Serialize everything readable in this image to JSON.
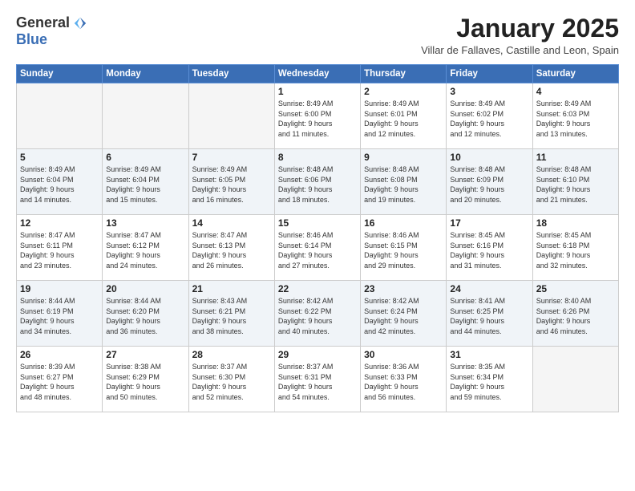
{
  "logo": {
    "general": "General",
    "blue": "Blue"
  },
  "header": {
    "month": "January 2025",
    "location": "Villar de Fallaves, Castille and Leon, Spain"
  },
  "weekdays": [
    "Sunday",
    "Monday",
    "Tuesday",
    "Wednesday",
    "Thursday",
    "Friday",
    "Saturday"
  ],
  "weeks": [
    [
      {
        "day": "",
        "info": ""
      },
      {
        "day": "",
        "info": ""
      },
      {
        "day": "",
        "info": ""
      },
      {
        "day": "1",
        "info": "Sunrise: 8:49 AM\nSunset: 6:00 PM\nDaylight: 9 hours\nand 11 minutes."
      },
      {
        "day": "2",
        "info": "Sunrise: 8:49 AM\nSunset: 6:01 PM\nDaylight: 9 hours\nand 12 minutes."
      },
      {
        "day": "3",
        "info": "Sunrise: 8:49 AM\nSunset: 6:02 PM\nDaylight: 9 hours\nand 12 minutes."
      },
      {
        "day": "4",
        "info": "Sunrise: 8:49 AM\nSunset: 6:03 PM\nDaylight: 9 hours\nand 13 minutes."
      }
    ],
    [
      {
        "day": "5",
        "info": "Sunrise: 8:49 AM\nSunset: 6:04 PM\nDaylight: 9 hours\nand 14 minutes."
      },
      {
        "day": "6",
        "info": "Sunrise: 8:49 AM\nSunset: 6:04 PM\nDaylight: 9 hours\nand 15 minutes."
      },
      {
        "day": "7",
        "info": "Sunrise: 8:49 AM\nSunset: 6:05 PM\nDaylight: 9 hours\nand 16 minutes."
      },
      {
        "day": "8",
        "info": "Sunrise: 8:48 AM\nSunset: 6:06 PM\nDaylight: 9 hours\nand 18 minutes."
      },
      {
        "day": "9",
        "info": "Sunrise: 8:48 AM\nSunset: 6:08 PM\nDaylight: 9 hours\nand 19 minutes."
      },
      {
        "day": "10",
        "info": "Sunrise: 8:48 AM\nSunset: 6:09 PM\nDaylight: 9 hours\nand 20 minutes."
      },
      {
        "day": "11",
        "info": "Sunrise: 8:48 AM\nSunset: 6:10 PM\nDaylight: 9 hours\nand 21 minutes."
      }
    ],
    [
      {
        "day": "12",
        "info": "Sunrise: 8:47 AM\nSunset: 6:11 PM\nDaylight: 9 hours\nand 23 minutes."
      },
      {
        "day": "13",
        "info": "Sunrise: 8:47 AM\nSunset: 6:12 PM\nDaylight: 9 hours\nand 24 minutes."
      },
      {
        "day": "14",
        "info": "Sunrise: 8:47 AM\nSunset: 6:13 PM\nDaylight: 9 hours\nand 26 minutes."
      },
      {
        "day": "15",
        "info": "Sunrise: 8:46 AM\nSunset: 6:14 PM\nDaylight: 9 hours\nand 27 minutes."
      },
      {
        "day": "16",
        "info": "Sunrise: 8:46 AM\nSunset: 6:15 PM\nDaylight: 9 hours\nand 29 minutes."
      },
      {
        "day": "17",
        "info": "Sunrise: 8:45 AM\nSunset: 6:16 PM\nDaylight: 9 hours\nand 31 minutes."
      },
      {
        "day": "18",
        "info": "Sunrise: 8:45 AM\nSunset: 6:18 PM\nDaylight: 9 hours\nand 32 minutes."
      }
    ],
    [
      {
        "day": "19",
        "info": "Sunrise: 8:44 AM\nSunset: 6:19 PM\nDaylight: 9 hours\nand 34 minutes."
      },
      {
        "day": "20",
        "info": "Sunrise: 8:44 AM\nSunset: 6:20 PM\nDaylight: 9 hours\nand 36 minutes."
      },
      {
        "day": "21",
        "info": "Sunrise: 8:43 AM\nSunset: 6:21 PM\nDaylight: 9 hours\nand 38 minutes."
      },
      {
        "day": "22",
        "info": "Sunrise: 8:42 AM\nSunset: 6:22 PM\nDaylight: 9 hours\nand 40 minutes."
      },
      {
        "day": "23",
        "info": "Sunrise: 8:42 AM\nSunset: 6:24 PM\nDaylight: 9 hours\nand 42 minutes."
      },
      {
        "day": "24",
        "info": "Sunrise: 8:41 AM\nSunset: 6:25 PM\nDaylight: 9 hours\nand 44 minutes."
      },
      {
        "day": "25",
        "info": "Sunrise: 8:40 AM\nSunset: 6:26 PM\nDaylight: 9 hours\nand 46 minutes."
      }
    ],
    [
      {
        "day": "26",
        "info": "Sunrise: 8:39 AM\nSunset: 6:27 PM\nDaylight: 9 hours\nand 48 minutes."
      },
      {
        "day": "27",
        "info": "Sunrise: 8:38 AM\nSunset: 6:29 PM\nDaylight: 9 hours\nand 50 minutes."
      },
      {
        "day": "28",
        "info": "Sunrise: 8:37 AM\nSunset: 6:30 PM\nDaylight: 9 hours\nand 52 minutes."
      },
      {
        "day": "29",
        "info": "Sunrise: 8:37 AM\nSunset: 6:31 PM\nDaylight: 9 hours\nand 54 minutes."
      },
      {
        "day": "30",
        "info": "Sunrise: 8:36 AM\nSunset: 6:33 PM\nDaylight: 9 hours\nand 56 minutes."
      },
      {
        "day": "31",
        "info": "Sunrise: 8:35 AM\nSunset: 6:34 PM\nDaylight: 9 hours\nand 59 minutes."
      },
      {
        "day": "",
        "info": ""
      }
    ]
  ]
}
